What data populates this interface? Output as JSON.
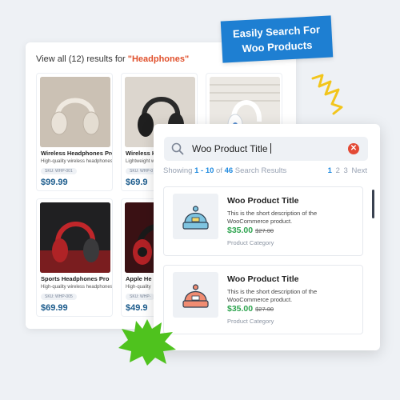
{
  "results": {
    "heading_prefix": "View all (12) results for ",
    "heading_query": "\"Headphones\"",
    "products": [
      {
        "title": "Wireless Headphones Pro",
        "desc": "High-quality wireless headphones",
        "sku": "SKU: WHP-001",
        "price": "$99.99"
      },
      {
        "title": "Wireless H",
        "desc": "Lightweight w",
        "sku": "SKU: WHP-0",
        "price": "$69.9"
      },
      {
        "title": "",
        "desc": "",
        "sku": "",
        "price": ""
      },
      {
        "title": "Sports Headphones Pro",
        "desc": "High-quality wireless headphones",
        "sku": "SKU: WHP-005",
        "price": "$69.99"
      },
      {
        "title": "Apple He",
        "desc": "High-quality",
        "sku": "SKU: WHP-",
        "price": "$49.9"
      }
    ]
  },
  "banner": {
    "line1": "Easily Search For",
    "line2": "Woo Products",
    "color": "#1e7fd2"
  },
  "search": {
    "query": "Woo Product Title",
    "clear_icon": "close-icon",
    "search_icon": "search-icon",
    "showing_prefix": "Showing ",
    "showing_range": "1 - 10",
    "showing_of": " of ",
    "showing_total": "46",
    "showing_suffix": " Search Results",
    "pages": [
      "1",
      "2",
      "3"
    ],
    "next_label": "Next",
    "items": [
      {
        "title": "Woo Product Title",
        "desc": "This is the short description of the WooCommerce product.",
        "price": "$35.00",
        "old_price": "$27.00",
        "category": "Product Category",
        "beanie_color": "#7fc4e0"
      },
      {
        "title": "Woo Product Title",
        "desc": "This is the short description of the WooCommerce product.",
        "price": "$35.00",
        "old_price": "$27.00",
        "category": "Product Category",
        "beanie_color": "#f08c72"
      }
    ]
  },
  "colors": {
    "accent": "#1f8ae0",
    "price_green": "#2ea44f",
    "query_orange": "#e0502c",
    "burst_green": "#4fc21e",
    "doodle_yellow": "#f2c51b"
  }
}
